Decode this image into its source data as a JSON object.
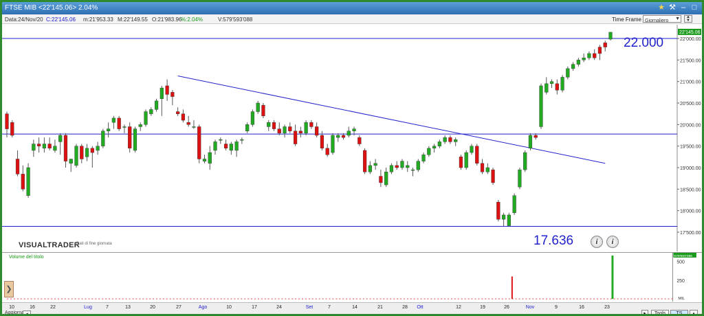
{
  "window": {
    "title": "FTSE MIB <22'145.06> 2.04%",
    "icons": [
      "star-icon",
      "tools-icon",
      "minimize-icon",
      "maximize-icon",
      "close-icon"
    ]
  },
  "infobar": {
    "date": "Data:24/Nov/20",
    "close": "C:22'145.06",
    "min": "m:21'953.33",
    "max": "M:22'149.55",
    "open": "O:21'983.96",
    "pct": "%:2.04%",
    "volume": "V:579'593'088",
    "timeframe_label": "Time Frame",
    "timeframe_value": "Giornaliero"
  },
  "price_axis": {
    "labels": [
      "22'000.00",
      "21'500.00",
      "21'000.00",
      "20'500.00",
      "20'000.00",
      "19'500.00",
      "19'000.00",
      "18'500.00",
      "18'000.00",
      "17'500.00"
    ],
    "last_price": "22'145.06"
  },
  "annotations": {
    "resistance": "22.000",
    "support": "17.636"
  },
  "volume_panel": {
    "title": "Volume del titolo",
    "labels": [
      "500",
      "250"
    ],
    "unit": "MIL",
    "last_volume": "579'593'088"
  },
  "x_axis": {
    "labels": [
      "10",
      "16",
      "22",
      "Lug",
      "7",
      "13",
      "20",
      "27",
      "Ago",
      "10",
      "17",
      "24",
      "Set",
      "7",
      "14",
      "21",
      "28",
      "Ott",
      "12",
      "19",
      "26",
      "Nov",
      "9",
      "16",
      "23"
    ]
  },
  "logo": {
    "name": "VISUALTRADER",
    "sub": "Dati di fine giornata"
  },
  "bottom": {
    "refresh": "Aggiorna",
    "tools": "Tools",
    "ts_off": "TS OFF"
  },
  "colors": {
    "up": "#22aa22",
    "down": "#dd1111",
    "lines": "#2222cc",
    "frame": "#2f8a2f"
  },
  "chart_data": {
    "type": "candlestick",
    "title": "FTSE MIB",
    "ylim": [
      17500,
      22200
    ],
    "candles": [
      {
        "o": 20250,
        "h": 20300,
        "l": 19700,
        "c": 19900
      },
      {
        "o": 20050,
        "h": 20100,
        "l": 19700,
        "c": 19750
      },
      {
        "o": 19200,
        "h": 19400,
        "l": 18800,
        "c": 18850
      },
      {
        "o": 18850,
        "h": 19050,
        "l": 18450,
        "c": 18500
      },
      {
        "o": 18350,
        "h": 19100,
        "l": 18300,
        "c": 19000
      },
      {
        "o": 19400,
        "h": 19650,
        "l": 19250,
        "c": 19550
      },
      {
        "o": 19550,
        "h": 19700,
        "l": 19350,
        "c": 19500
      },
      {
        "o": 19450,
        "h": 19700,
        "l": 19350,
        "c": 19550
      },
      {
        "o": 19550,
        "h": 19700,
        "l": 19400,
        "c": 19450
      },
      {
        "o": 19400,
        "h": 19650,
        "l": 19350,
        "c": 19500
      },
      {
        "o": 19600,
        "h": 19800,
        "l": 19300,
        "c": 19750
      },
      {
        "o": 19750,
        "h": 19800,
        "l": 19000,
        "c": 19150
      },
      {
        "o": 19100,
        "h": 19200,
        "l": 18900,
        "c": 19200
      },
      {
        "o": 19050,
        "h": 19550,
        "l": 19000,
        "c": 19500
      },
      {
        "o": 19500,
        "h": 19550,
        "l": 19100,
        "c": 19200
      },
      {
        "o": 19250,
        "h": 19550,
        "l": 19150,
        "c": 19450
      },
      {
        "o": 19450,
        "h": 19500,
        "l": 19000,
        "c": 19350
      },
      {
        "o": 19400,
        "h": 19600,
        "l": 19300,
        "c": 19500
      },
      {
        "o": 19500,
        "h": 19900,
        "l": 19450,
        "c": 19850
      },
      {
        "o": 19850,
        "h": 20050,
        "l": 19700,
        "c": 19900
      },
      {
        "o": 20050,
        "h": 20200,
        "l": 19900,
        "c": 20150
      },
      {
        "o": 20150,
        "h": 20200,
        "l": 19850,
        "c": 19900
      },
      {
        "o": 19950,
        "h": 20000,
        "l": 19800,
        "c": 19950
      },
      {
        "o": 19950,
        "h": 20050,
        "l": 19350,
        "c": 19450
      },
      {
        "o": 19400,
        "h": 19950,
        "l": 19350,
        "c": 19900
      },
      {
        "o": 19950,
        "h": 20050,
        "l": 19850,
        "c": 20000
      },
      {
        "o": 20000,
        "h": 20350,
        "l": 19950,
        "c": 20300
      },
      {
        "o": 20250,
        "h": 20400,
        "l": 20200,
        "c": 20350
      },
      {
        "o": 20350,
        "h": 20600,
        "l": 20300,
        "c": 20550
      },
      {
        "o": 20600,
        "h": 20900,
        "l": 20200,
        "c": 20850
      },
      {
        "o": 20900,
        "h": 21050,
        "l": 20550,
        "c": 20700
      },
      {
        "o": 20750,
        "h": 20800,
        "l": 20450,
        "c": 20650
      },
      {
        "o": 20300,
        "h": 20400,
        "l": 20200,
        "c": 20250
      },
      {
        "o": 20250,
        "h": 20350,
        "l": 20050,
        "c": 20100
      },
      {
        "o": 20050,
        "h": 20200,
        "l": 19950,
        "c": 20000
      },
      {
        "o": 19950,
        "h": 20100,
        "l": 19900,
        "c": 19950
      },
      {
        "o": 19950,
        "h": 20000,
        "l": 19100,
        "c": 19200
      },
      {
        "o": 19150,
        "h": 19300,
        "l": 19100,
        "c": 19200
      },
      {
        "o": 19100,
        "h": 19500,
        "l": 18950,
        "c": 19350
      },
      {
        "o": 19400,
        "h": 19650,
        "l": 19300,
        "c": 19600
      },
      {
        "o": 19650,
        "h": 19700,
        "l": 19550,
        "c": 19650
      },
      {
        "o": 19550,
        "h": 19650,
        "l": 19400,
        "c": 19450
      },
      {
        "o": 19400,
        "h": 19600,
        "l": 19300,
        "c": 19550
      },
      {
        "o": 19400,
        "h": 19650,
        "l": 19250,
        "c": 19600
      },
      {
        "o": 19650,
        "h": 19700,
        "l": 19550,
        "c": 19650
      },
      {
        "o": 19850,
        "h": 20050,
        "l": 19800,
        "c": 20000
      },
      {
        "o": 20000,
        "h": 20350,
        "l": 19950,
        "c": 20300
      },
      {
        "o": 20300,
        "h": 20550,
        "l": 20250,
        "c": 20500
      },
      {
        "o": 20450,
        "h": 20500,
        "l": 20150,
        "c": 20200
      },
      {
        "o": 19950,
        "h": 20100,
        "l": 19850,
        "c": 20050
      },
      {
        "o": 20050,
        "h": 20100,
        "l": 19850,
        "c": 19900
      },
      {
        "o": 19900,
        "h": 20050,
        "l": 19750,
        "c": 19800
      },
      {
        "o": 19800,
        "h": 20000,
        "l": 19700,
        "c": 19950
      },
      {
        "o": 19950,
        "h": 20050,
        "l": 19800,
        "c": 19850
      },
      {
        "o": 19850,
        "h": 20000,
        "l": 19500,
        "c": 19550
      },
      {
        "o": 19850,
        "h": 19950,
        "l": 19700,
        "c": 19800
      },
      {
        "o": 19800,
        "h": 20100,
        "l": 19750,
        "c": 20050
      },
      {
        "o": 20050,
        "h": 20100,
        "l": 19900,
        "c": 19950
      },
      {
        "o": 19950,
        "h": 20050,
        "l": 19700,
        "c": 19750
      },
      {
        "o": 19750,
        "h": 19850,
        "l": 19400,
        "c": 19450
      },
      {
        "o": 19450,
        "h": 19550,
        "l": 19250,
        "c": 19300
      },
      {
        "o": 19350,
        "h": 19800,
        "l": 19300,
        "c": 19750
      },
      {
        "o": 19700,
        "h": 19800,
        "l": 19600,
        "c": 19750
      },
      {
        "o": 19750,
        "h": 19800,
        "l": 19650,
        "c": 19700
      },
      {
        "o": 19750,
        "h": 19950,
        "l": 19700,
        "c": 19850
      },
      {
        "o": 19850,
        "h": 19950,
        "l": 19750,
        "c": 19900
      },
      {
        "o": 19700,
        "h": 19750,
        "l": 19500,
        "c": 19550
      },
      {
        "o": 19400,
        "h": 19450,
        "l": 18850,
        "c": 18900
      },
      {
        "o": 18900,
        "h": 19150,
        "l": 18850,
        "c": 19050
      },
      {
        "o": 19050,
        "h": 19200,
        "l": 18950,
        "c": 19100
      },
      {
        "o": 18800,
        "h": 18950,
        "l": 18550,
        "c": 18650
      },
      {
        "o": 18600,
        "h": 19000,
        "l": 18550,
        "c": 18900
      },
      {
        "o": 18900,
        "h": 19100,
        "l": 18850,
        "c": 19050
      },
      {
        "o": 19050,
        "h": 19150,
        "l": 18950,
        "c": 19000
      },
      {
        "o": 19000,
        "h": 19200,
        "l": 18950,
        "c": 19150
      },
      {
        "o": 19000,
        "h": 19150,
        "l": 18900,
        "c": 19050
      },
      {
        "o": 18950,
        "h": 19000,
        "l": 18800,
        "c": 18950
      },
      {
        "o": 18950,
        "h": 19200,
        "l": 18900,
        "c": 19150
      },
      {
        "o": 19150,
        "h": 19350,
        "l": 19100,
        "c": 19300
      },
      {
        "o": 19300,
        "h": 19500,
        "l": 19250,
        "c": 19450
      },
      {
        "o": 19450,
        "h": 19550,
        "l": 19350,
        "c": 19500
      },
      {
        "o": 19500,
        "h": 19650,
        "l": 19450,
        "c": 19600
      },
      {
        "o": 19600,
        "h": 19750,
        "l": 19550,
        "c": 19700
      },
      {
        "o": 19700,
        "h": 19750,
        "l": 19550,
        "c": 19600
      },
      {
        "o": 19600,
        "h": 19700,
        "l": 19500,
        "c": 19650
      },
      {
        "o": 19250,
        "h": 19300,
        "l": 18950,
        "c": 19000
      },
      {
        "o": 19000,
        "h": 19400,
        "l": 18950,
        "c": 19350
      },
      {
        "o": 19350,
        "h": 19550,
        "l": 19300,
        "c": 19500
      },
      {
        "o": 19500,
        "h": 19550,
        "l": 19050,
        "c": 19100
      },
      {
        "o": 19100,
        "h": 19200,
        "l": 18850,
        "c": 18900
      },
      {
        "o": 18900,
        "h": 19100,
        "l": 18850,
        "c": 19000
      },
      {
        "o": 18950,
        "h": 19000,
        "l": 18600,
        "c": 18650
      },
      {
        "o": 18200,
        "h": 18250,
        "l": 17750,
        "c": 17800
      },
      {
        "o": 17800,
        "h": 17950,
        "l": 17636,
        "c": 17900
      },
      {
        "o": 17650,
        "h": 17950,
        "l": 17636,
        "c": 17900
      },
      {
        "o": 17950,
        "h": 18400,
        "l": 17900,
        "c": 18350
      },
      {
        "o": 18550,
        "h": 19000,
        "l": 18500,
        "c": 18950
      },
      {
        "o": 18950,
        "h": 19400,
        "l": 18900,
        "c": 19350
      },
      {
        "o": 19450,
        "h": 19800,
        "l": 19400,
        "c": 19750
      },
      {
        "o": 19750,
        "h": 19800,
        "l": 19650,
        "c": 19700
      },
      {
        "o": 19950,
        "h": 20950,
        "l": 19900,
        "c": 20900
      },
      {
        "o": 20750,
        "h": 21100,
        "l": 20700,
        "c": 20950
      },
      {
        "o": 20950,
        "h": 21050,
        "l": 20850,
        "c": 21000
      },
      {
        "o": 20950,
        "h": 21050,
        "l": 20700,
        "c": 20800
      },
      {
        "o": 20800,
        "h": 21150,
        "l": 20750,
        "c": 21100
      },
      {
        "o": 21100,
        "h": 21350,
        "l": 21050,
        "c": 21300
      },
      {
        "o": 21300,
        "h": 21450,
        "l": 21250,
        "c": 21400
      },
      {
        "o": 21400,
        "h": 21550,
        "l": 21350,
        "c": 21500
      },
      {
        "o": 21500,
        "h": 21650,
        "l": 21450,
        "c": 21550
      },
      {
        "o": 21550,
        "h": 21700,
        "l": 21500,
        "c": 21650
      },
      {
        "o": 21650,
        "h": 21750,
        "l": 21500,
        "c": 21550
      },
      {
        "o": 21800,
        "h": 21850,
        "l": 21500,
        "c": 21650
      },
      {
        "o": 21900,
        "h": 21950,
        "l": 21700,
        "c": 21800
      },
      {
        "o": 21983.96,
        "h": 22149.55,
        "l": 21953.33,
        "c": 22145.06
      }
    ],
    "horizontal_lines": [
      22000,
      19780,
      17636
    ],
    "trendline": [
      {
        "i": 32,
        "y": 21130
      },
      {
        "i": 112,
        "y": 19100
      }
    ],
    "volume_spikes": [
      {
        "i": 95,
        "v": 300,
        "color": "down"
      },
      {
        "i": 114,
        "v": 580,
        "color": "up"
      }
    ],
    "volume_ylim": [
      0,
      580
    ]
  }
}
